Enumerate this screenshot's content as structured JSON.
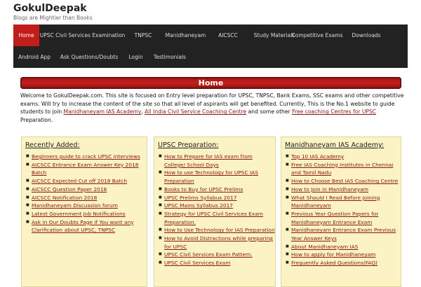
{
  "site": {
    "title": "GokulDeepak",
    "tagline": "Blogs are Mightier than Books"
  },
  "nav": {
    "items": [
      "Home",
      "UPSC Civil Services Examination",
      "TNPSC",
      "Manidhaneyam",
      "AICSCC",
      "Study Materials",
      "Competitive Exams",
      "Downloads",
      "Android App",
      "Ask Questions/Doubts",
      "Login",
      "Testimonials"
    ],
    "active": "Home"
  },
  "page": {
    "heading": "Home"
  },
  "intro": {
    "text1": "Welcome to GokulDeepak.com. This site is focused on Entry level preparation for UPSC, TNPSC, Bank Exams, SSC exams and other competitive exams. Will try to increase the content of the site so that all level of aspirants will get benefited. Currently, This is the No.1 website to guide students to join ",
    "link1": "Manidhaneyam IAS Academy",
    "sep1": ", ",
    "link2": "All India Civil Service Coaching Centre",
    "text2": " and some other ",
    "link3": "Free coaching Centres for UPSC",
    "text3": " Preparation."
  },
  "panels": [
    {
      "title": "Recently Added:",
      "items": [
        "Beginners guide to crack UPSC interviews",
        "AICSCC Entrance Exam Answer Key 2018 Batch",
        "AICSCC Expected Cut off 2018 Batch",
        "AICSCC Question Paper 2018",
        "AICSCC Notification 2018",
        "Manidhaneyam Discussion forum",
        "Latest Government Job Notifications",
        "Ask in Our Doubts Page if You want any Clarification about UPSC, TNPSC"
      ]
    },
    {
      "title": "UPSC Preparation:",
      "items": [
        "How to Prepare for IAS exam from College/ School Days",
        "How to use Technology for UPSC IAS Preparation",
        "Books to Buy for UPSC Prelims",
        "UPSC Prelims Syllabus 2017",
        "UPSC Mains Syllabus 2017",
        "Strategy for UPSC Civil Services Exam Preparation.",
        "How to Use Technology for IAS Preparation",
        "How to Avoid Distractions while preparing for UPSC",
        "UPSC Civil Services Exam Pattern.",
        "UPSC Civil Services Exam"
      ]
    },
    {
      "title": "Manidhaneyam IAS Academy:",
      "items": [
        "Top 10 IAS Academy",
        "Free IAS Coaching Institutes in Chennai and Tamil Nadu",
        "How to Choose Best IAS Coaching Centre",
        "How to Join in Manidhaneyam",
        "What Should I Read Before Joining Manidhaneyam",
        "Previous Year Question Papers for Manidhaneyam Entrance Exam",
        "Manidhaneyam Entrance Exam Previous Year Answer Keys",
        "About Manidhaneyam IAS",
        "How to apply for Manidhaneyam",
        "Frequently Asked Questions(FAQ)"
      ]
    }
  ]
}
